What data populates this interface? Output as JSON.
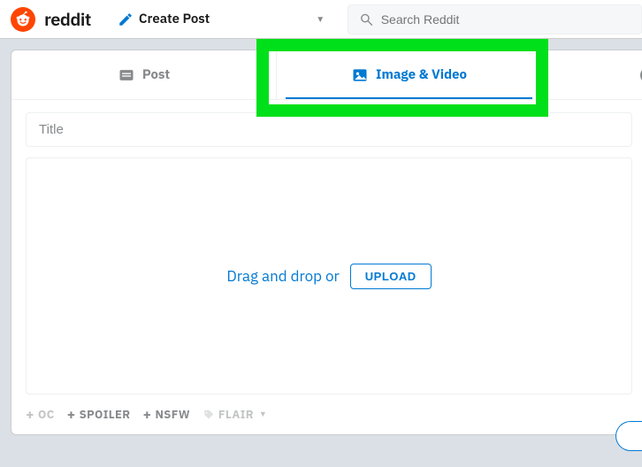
{
  "header": {
    "brand": "reddit",
    "create_label": "Create Post",
    "search_placeholder": "Search Reddit"
  },
  "tabs": {
    "post": "Post",
    "image_video": "Image & Video"
  },
  "composer": {
    "title_placeholder": "Title",
    "drop_text": "Drag and drop or",
    "upload_label": "Upload"
  },
  "flags": {
    "oc": "OC",
    "spoiler": "SPOILER",
    "nsfw": "NSFW",
    "flair": "FLAIR"
  }
}
